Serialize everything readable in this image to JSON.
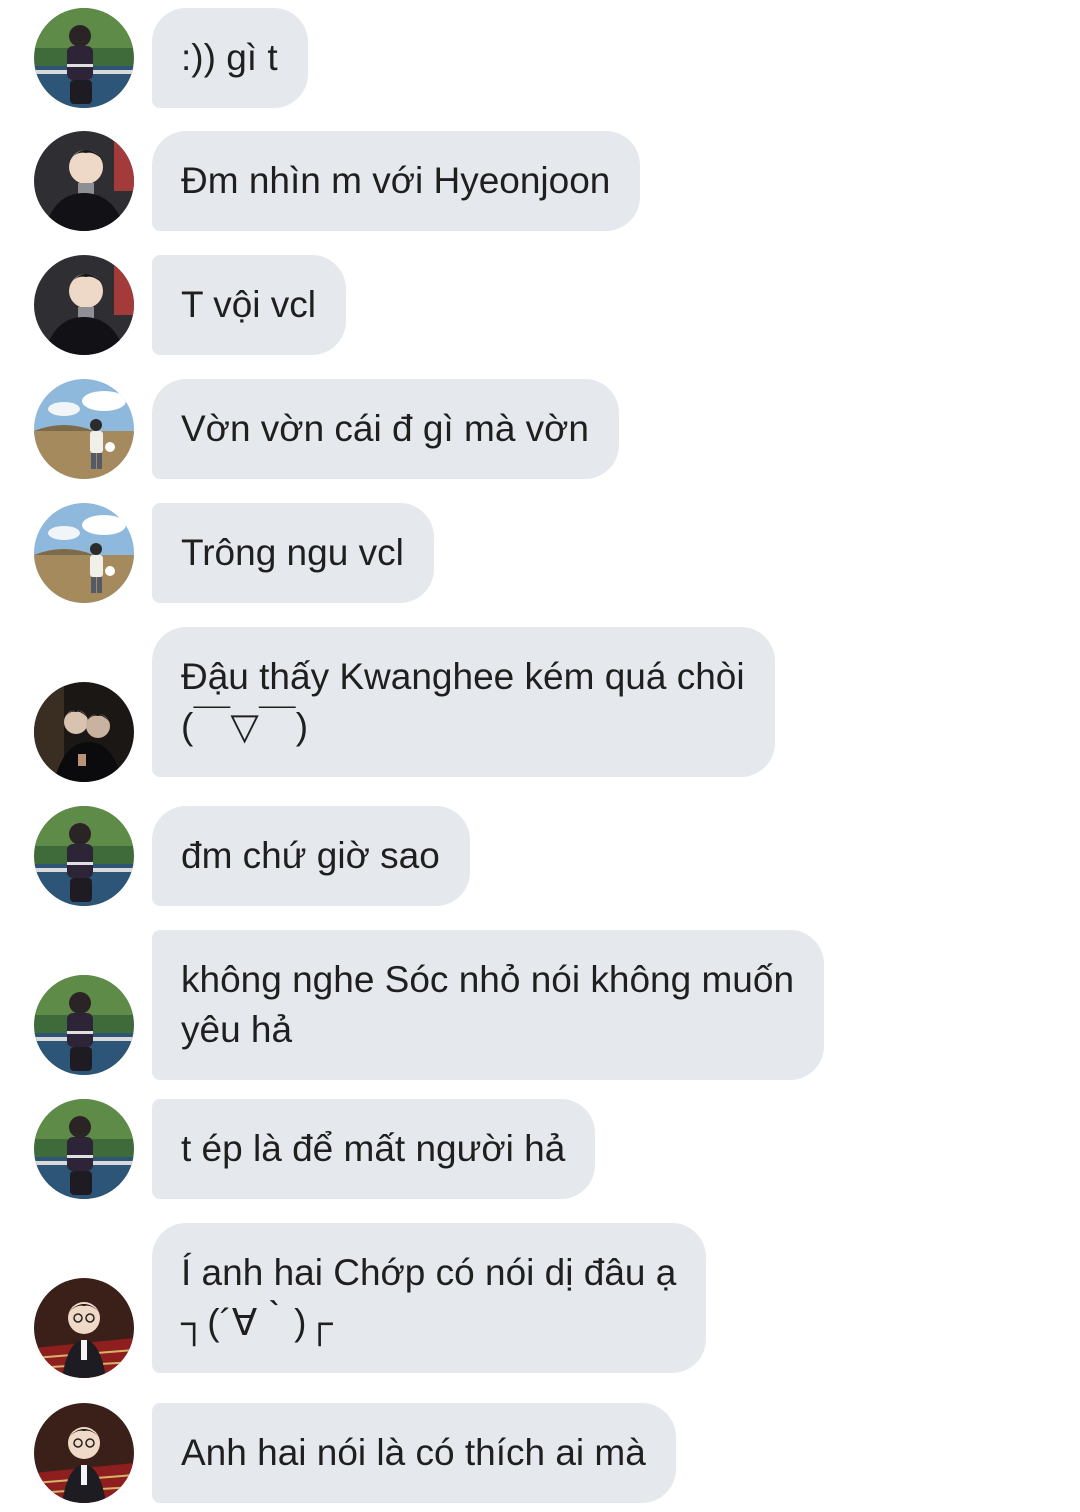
{
  "conversation": {
    "messages": [
      {
        "avatar": "avatar-purple-jacket-court",
        "lines": [
          ":)) gì t"
        ]
      },
      {
        "avatar": "avatar-black-coat",
        "lines": [
          "Đm nhìn m với Hyeonjoon"
        ]
      },
      {
        "avatar": "avatar-black-coat",
        "lines": [
          "T vội vcl"
        ]
      },
      {
        "avatar": "avatar-field-sky",
        "lines": [
          "Vờn vờn cái đ gì mà vờn"
        ]
      },
      {
        "avatar": "avatar-field-sky",
        "lines": [
          "Trông ngu vcl"
        ]
      },
      {
        "avatar": "avatar-dark-couple",
        "lines": [
          "Đậu thấy Kwanghee kém quá chòi",
          "(￣▽￣)"
        ]
      },
      {
        "avatar": "avatar-purple-jacket-court",
        "lines": [
          "đm chứ giờ sao"
        ]
      },
      {
        "avatar": "avatar-purple-jacket-court",
        "lines": [
          "không nghe Sóc nhỏ nói không muốn",
          "yêu hả"
        ]
      },
      {
        "avatar": "avatar-purple-jacket-court",
        "lines": [
          "t ép là để mất người hả"
        ]
      },
      {
        "avatar": "avatar-red-plaid",
        "lines": [
          "Í anh hai Chớp có nói dị đâu ạ",
          "┐(´∀｀)┌"
        ]
      },
      {
        "avatar": "avatar-red-plaid",
        "lines": [
          "Anh hai nói là có thích ai mà"
        ]
      }
    ]
  },
  "colors": {
    "bubble_bg": "#e5e9ee",
    "text": "#1f1f1f",
    "background": "#ffffff"
  }
}
